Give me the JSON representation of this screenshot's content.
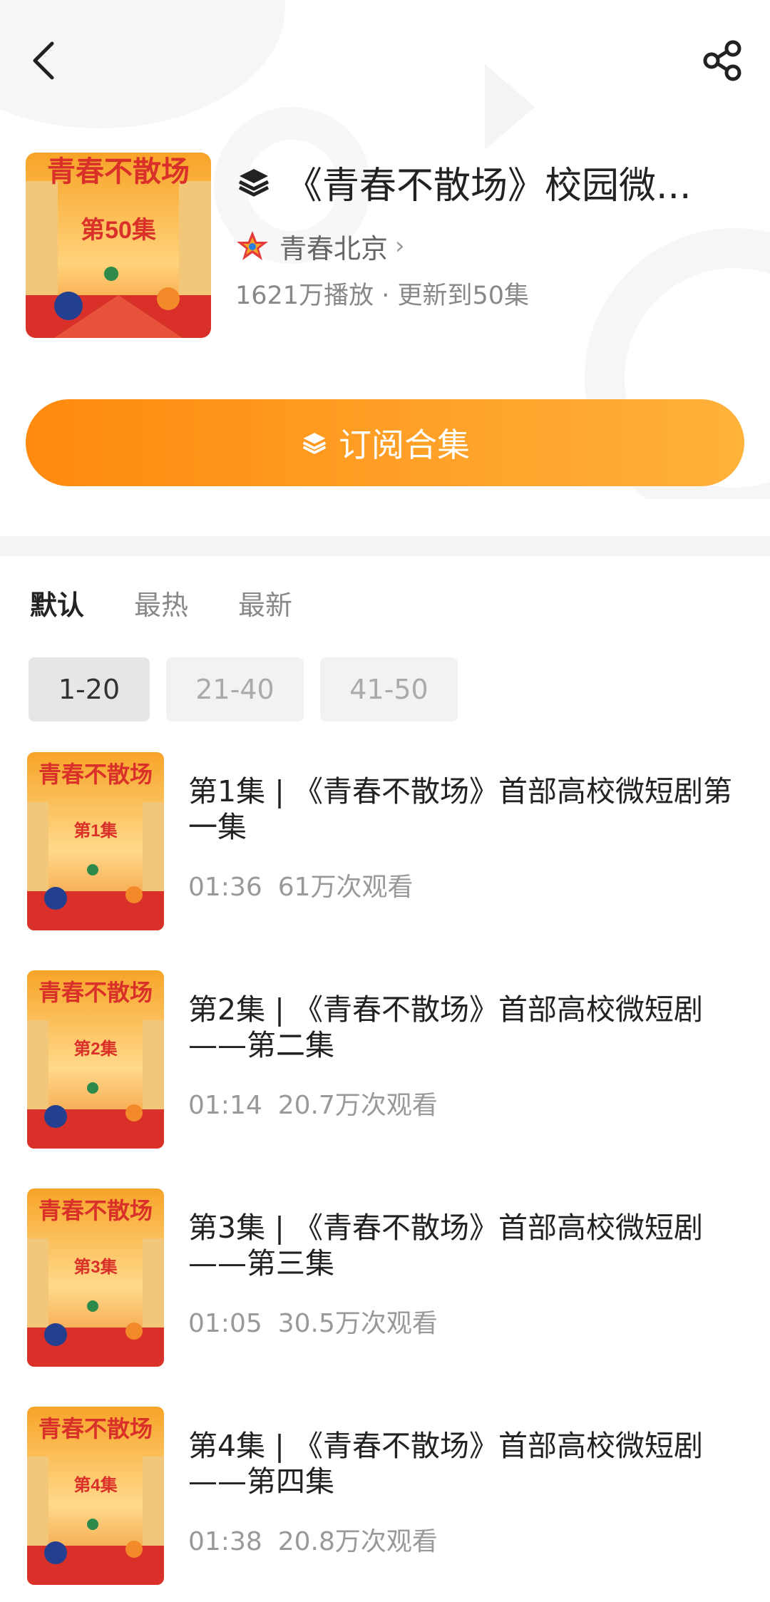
{
  "topbar": {
    "back_icon": "back-icon",
    "share_icon": "share-icon"
  },
  "header": {
    "cover_title": "青春不散场",
    "cover_episode": "第50集",
    "title": "《青春不散场》校园微...",
    "author": "青春北京",
    "stats": "1621万播放 · 更新到50集"
  },
  "subscribe": {
    "label": "订阅合集"
  },
  "sorts": [
    "默认",
    "最热",
    "最新"
  ],
  "ranges": [
    "1-20",
    "21-40",
    "41-50"
  ],
  "episodes": [
    {
      "title": "第1集 | 《青春不散场》首部高校微短剧第一集",
      "duration": "01:36",
      "views": "61万次观看",
      "thumb_label": "第1集",
      "thumb_title": "青春不散场"
    },
    {
      "title": "第2集 | 《青春不散场》首部高校微短剧——第二集",
      "duration": "01:14",
      "views": "20.7万次观看",
      "thumb_label": "第2集",
      "thumb_title": "青春不散场"
    },
    {
      "title": "第3集 | 《青春不散场》首部高校微短剧——第三集",
      "duration": "01:05",
      "views": "30.5万次观看",
      "thumb_label": "第3集",
      "thumb_title": "青春不散场"
    },
    {
      "title": "第4集 | 《青春不散场》首部高校微短剧——第四集",
      "duration": "01:38",
      "views": "20.8万次观看",
      "thumb_label": "第4集",
      "thumb_title": "青春不散场"
    }
  ],
  "colors": {
    "accent": "#ff8a0f",
    "accent_light": "#ffb23a",
    "cover_red": "#d9302a"
  }
}
